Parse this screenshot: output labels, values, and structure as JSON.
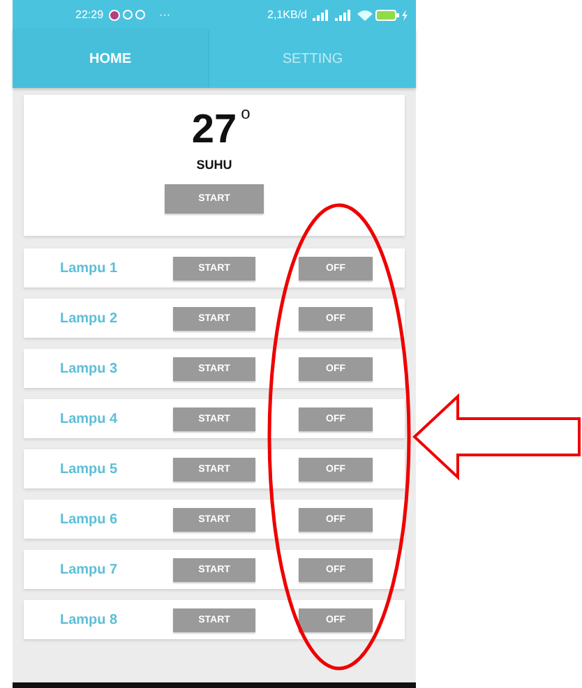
{
  "status_bar": {
    "time": "22:29",
    "more": "···",
    "speed": "2,1KB/d"
  },
  "tabs": [
    {
      "label": "HOME",
      "selected": true
    },
    {
      "label": "SETTING",
      "selected": false
    }
  ],
  "temperature": {
    "value": "27",
    "unit": "o",
    "label": "SUHU",
    "button": "START"
  },
  "lamps": [
    {
      "name": "Lampu 1",
      "start": "START",
      "toggle": "OFF"
    },
    {
      "name": "Lampu 2",
      "start": "START",
      "toggle": "OFF"
    },
    {
      "name": "Lampu 3",
      "start": "START",
      "toggle": "OFF"
    },
    {
      "name": "Lampu 4",
      "start": "START",
      "toggle": "OFF"
    },
    {
      "name": "Lampu 5",
      "start": "START",
      "toggle": "OFF"
    },
    {
      "name": "Lampu 6",
      "start": "START",
      "toggle": "OFF"
    },
    {
      "name": "Lampu 7",
      "start": "START",
      "toggle": "OFF"
    },
    {
      "name": "Lampu 8",
      "start": "START",
      "toggle": "OFF"
    }
  ]
}
